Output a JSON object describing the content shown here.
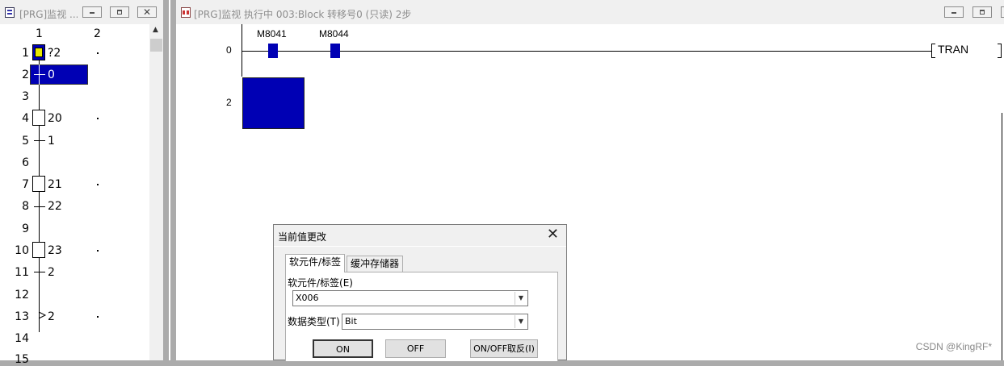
{
  "sfc_window": {
    "title": "[PRG]监视 ...",
    "col_headers": [
      "1",
      "2"
    ],
    "rows": [
      "1",
      "2",
      "3",
      "4",
      "5",
      "6",
      "7",
      "8",
      "9",
      "10",
      "11",
      "12",
      "13",
      "14",
      "15"
    ],
    "labels": {
      "r1": "?2",
      "r2": "0",
      "r4": "20",
      "r5": "1",
      "r7": "21",
      "r8": "22",
      "r10": "23",
      "r11": "2",
      "r13": "2"
    }
  },
  "ladder_window": {
    "title": "[PRG]监视 执行中 003:Block 转移号0 (只读) 2步",
    "rung_numbers": [
      "0",
      "2"
    ],
    "contacts": [
      "M8041",
      "M8044"
    ],
    "coil": "TRAN"
  },
  "dialog": {
    "title": "当前值更改",
    "close": "✕",
    "tabs": [
      "软元件/标签",
      "缓冲存储器"
    ],
    "device_label": "软元件/标签(E)",
    "device_value": "X006",
    "type_label": "数据类型(T)",
    "type_value": "Bit",
    "buttons": {
      "on": "ON",
      "off": "OFF",
      "toggle": "ON/OFF取反(I)"
    }
  },
  "watermark": "CSDN @KingRF*",
  "colors": {
    "highlight": "#0000b4",
    "step_active": "#e8e800"
  }
}
